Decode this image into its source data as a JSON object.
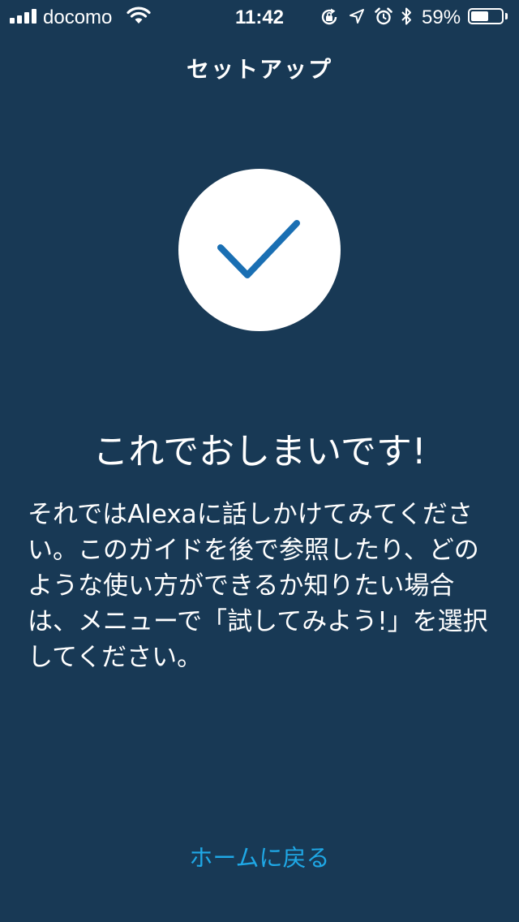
{
  "status_bar": {
    "carrier": "docomo",
    "time": "11:42",
    "battery_percent": "59%",
    "battery_level": 0.59,
    "signal_bars": 4,
    "icons": [
      "signal-icon",
      "wifi-icon",
      "orientation-lock-icon",
      "location-icon",
      "alarm-icon",
      "bluetooth-icon",
      "battery-icon"
    ]
  },
  "header": {
    "title": "セットアップ"
  },
  "main": {
    "status_icon": "checkmark-icon",
    "headline": "これでおしまいです!",
    "description": "それではAlexaに話しかけてみてください。このガイドを後で参照したり、どのような使い方ができるか知りたい場合は、メニューで「試してみよう!」を選択してください。"
  },
  "footer": {
    "home_link_label": "ホームに戻る"
  },
  "colors": {
    "background": "#183955",
    "link": "#1fa8e6",
    "check": "#1a6fb3",
    "text": "#ffffff"
  }
}
